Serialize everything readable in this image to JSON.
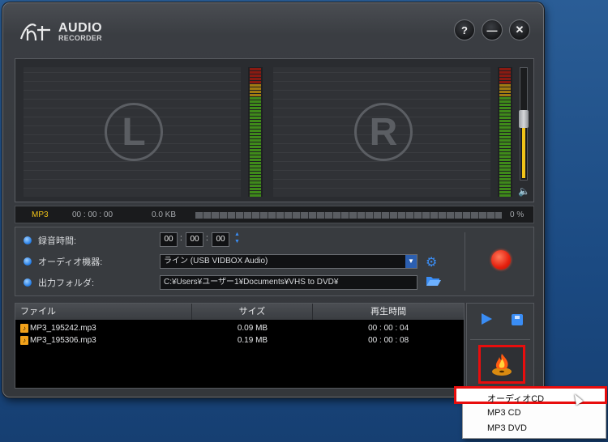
{
  "app": {
    "logo_mark": "ht",
    "logo_line1": "AUDIO",
    "logo_line2": "RECORDER"
  },
  "title_buttons": {
    "help": "?",
    "minimize": "—",
    "close": "✕"
  },
  "meter": {
    "left_label": "L",
    "right_label": "R",
    "volume_level": 0.55
  },
  "status": {
    "format": "MP3",
    "elapsed": "00 : 00 : 00",
    "size": "0.0 KB",
    "percent": "0 %"
  },
  "settings": {
    "rec_time_label": "録音時間:",
    "rec_time": {
      "h": "00",
      "m": "00",
      "s": "00"
    },
    "audio_device_label": "オーディオ機器:",
    "audio_device_value": "ライン (USB VIDBOX Audio)",
    "output_folder_label": "出力フォルダ:",
    "output_folder_value": "C:¥Users¥ユーザー1¥Documents¥VHS to DVD¥"
  },
  "files": {
    "columns": [
      "ファイル",
      "サイズ",
      "再生時間"
    ],
    "rows": [
      {
        "name": "MP3_195242.mp3",
        "size": "0.09 MB",
        "duration": "00 : 00 : 04"
      },
      {
        "name": "MP3_195306.mp3",
        "size": "0.19 MB",
        "duration": "00 : 00 : 08"
      }
    ]
  },
  "burn_menu": {
    "items": [
      "オーディオCD",
      "MP3 CD",
      "MP3 DVD"
    ],
    "selected": "オーディオCD"
  },
  "colors": {
    "accent_blue": "#3a8df5",
    "record_red": "#e5200e",
    "highlight_red": "#e80d0d",
    "format_yellow": "#f2c418"
  }
}
